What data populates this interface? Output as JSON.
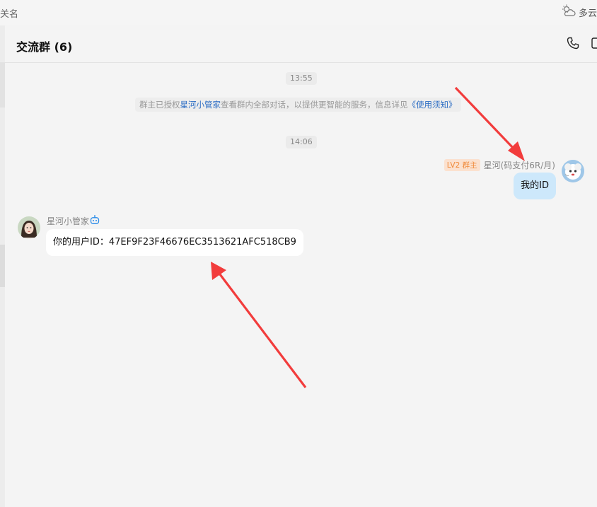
{
  "topbar": {
    "left_fragment": "关名",
    "weather_label": "多云"
  },
  "chat": {
    "title": "交流群 (6)",
    "timestamps": [
      "13:55",
      "14:06"
    ],
    "system_notice": {
      "prefix": "群主已授权",
      "bot_name": "星河小管家",
      "middle": "查看群内全部对话，以提供更智能的服务，信息详见",
      "link": "《使用须知》"
    },
    "messages": [
      {
        "side": "right",
        "level_badge": "LV2",
        "role_badge": "群主",
        "sender": "星河(码支付6R/月)",
        "text": "我的ID"
      },
      {
        "side": "left",
        "sender": "星河小管家",
        "text": "你的用户ID：47EF9F23F46676EC3513621AFC518CB9"
      }
    ]
  },
  "colors": {
    "self_bubble": "#cde8fb",
    "other_bubble": "#ffffff",
    "link": "#2a6cc4",
    "badge_bg": "#fbe1cf",
    "badge_text": "#f08a3a",
    "arrow": "#f23c3c"
  },
  "icons": {
    "weather": "cloud-sun-icon",
    "phone": "phone-icon",
    "bot": "robot-icon"
  }
}
